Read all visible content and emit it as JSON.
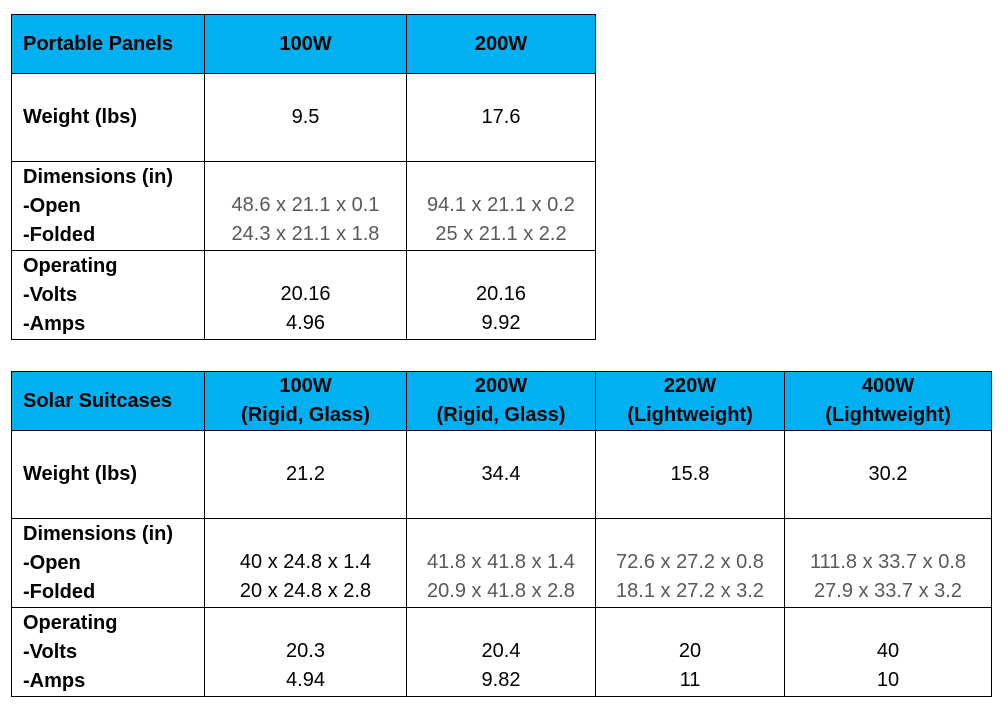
{
  "portable_panels": {
    "title": "Portable Panels",
    "columns": [
      "100W",
      "200W"
    ],
    "rows": {
      "weight": {
        "label": "Weight (lbs)",
        "values": [
          "9.5",
          "17.6"
        ]
      },
      "dimensions": {
        "label": "Dimensions (in)",
        "open_label": "-Open",
        "folded_label": "-Folded",
        "open": [
          "48.6 x 21.1 x 0.1",
          "94.1 x 21.1 x 0.2"
        ],
        "folded": [
          "24.3 x 21.1 x 1.8",
          "25 x 21.1 x 2.2"
        ]
      },
      "operating": {
        "label": "Operating",
        "volts_label": "-Volts",
        "amps_label": "-Amps",
        "volts": [
          "20.16",
          "20.16"
        ],
        "amps": [
          "4.96",
          "9.92"
        ]
      }
    }
  },
  "solar_suitcases": {
    "title": "Solar Suitcases",
    "columns": [
      {
        "watt": "100W",
        "type": "(Rigid, Glass)"
      },
      {
        "watt": "200W",
        "type": "(Rigid, Glass)"
      },
      {
        "watt": "220W",
        "type": "(Lightweight)"
      },
      {
        "watt": "400W",
        "type": "(Lightweight)"
      }
    ],
    "rows": {
      "weight": {
        "label": "Weight (lbs)",
        "values": [
          "21.2",
          "34.4",
          "15.8",
          "30.2"
        ]
      },
      "dimensions": {
        "label": "Dimensions (in)",
        "open_label": "-Open",
        "folded_label": "-Folded",
        "open": [
          "40 x 24.8 x 1.4",
          "41.8 x 41.8 x 1.4",
          "72.6 x 27.2 x 0.8",
          "111.8 x 33.7 x 0.8"
        ],
        "folded": [
          "20 x 24.8 x 2.8",
          "20.9 x 41.8 x 2.8",
          "18.1 x 27.2 x 3.2",
          "27.9 x 33.7 x 3.2"
        ]
      },
      "operating": {
        "label": "Operating",
        "volts_label": "-Volts",
        "amps_label": "-Amps",
        "volts": [
          "20.3",
          "20.4",
          "20",
          "40"
        ],
        "amps": [
          "4.94",
          "9.82",
          "11",
          "10"
        ]
      }
    }
  },
  "colors": {
    "header_bg": "#00b0f0",
    "dimension_text": "#595959",
    "text": "#000000"
  }
}
